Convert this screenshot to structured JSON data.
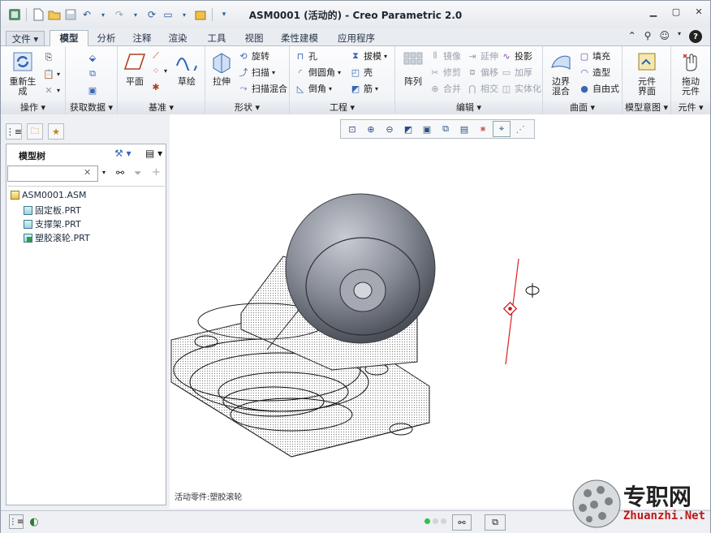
{
  "window": {
    "title": "ASM0001 (活动的) - Creo Parametric 2.0"
  },
  "tabs": [
    {
      "label": "文件"
    },
    {
      "label": "模型"
    },
    {
      "label": "分析"
    },
    {
      "label": "注释"
    },
    {
      "label": "渲染"
    },
    {
      "label": "工具"
    },
    {
      "label": "视图"
    },
    {
      "label": "柔性建模"
    },
    {
      "label": "应用程序"
    }
  ],
  "ribbon": {
    "operations": {
      "group": "操作",
      "regenerate": "重新生成"
    },
    "getdata": {
      "group": "获取数据"
    },
    "datum": {
      "group": "基准",
      "plane": "平面",
      "sketch": "草绘"
    },
    "shape": {
      "group": "形状",
      "extrude": "拉伸",
      "revolve": "旋转",
      "sweep": "扫描",
      "swept_blend": "扫描混合"
    },
    "engineering": {
      "group": "工程",
      "hole": "孔",
      "round": "倒圆角",
      "chamfer": "倒角",
      "draft": "拔模",
      "shell": "壳",
      "rib": "筋"
    },
    "editing": {
      "group": "编辑",
      "pattern": "阵列",
      "mirror": "镜像",
      "trim": "修剪",
      "merge": "合并",
      "extend": "延伸",
      "offset": "偏移",
      "intersect": "相交",
      "project": "投影",
      "thicken": "加厚",
      "solidify": "实体化"
    },
    "surfaces": {
      "group": "曲面",
      "boundary_blend": "边界混合",
      "fill": "填充",
      "style": "造型",
      "freestyle": "自由式"
    },
    "model_intent": {
      "group": "模型意图",
      "component_interface": "元件界面"
    },
    "component": {
      "group": "元件",
      "drag_components": "拖动元件"
    }
  },
  "leftpanel": {
    "title": "模型树",
    "search_value": "",
    "tree": [
      {
        "label": "ASM0001.ASM"
      },
      {
        "label": "固定板.PRT"
      },
      {
        "label": "支撑架.PRT"
      },
      {
        "label": "塑胶滚轮.PRT"
      }
    ]
  },
  "graphics": {
    "status": "活动零件:塑胶滚轮"
  },
  "watermark": {
    "text": "专职网",
    "url": "Zhuanzhi.Net"
  }
}
